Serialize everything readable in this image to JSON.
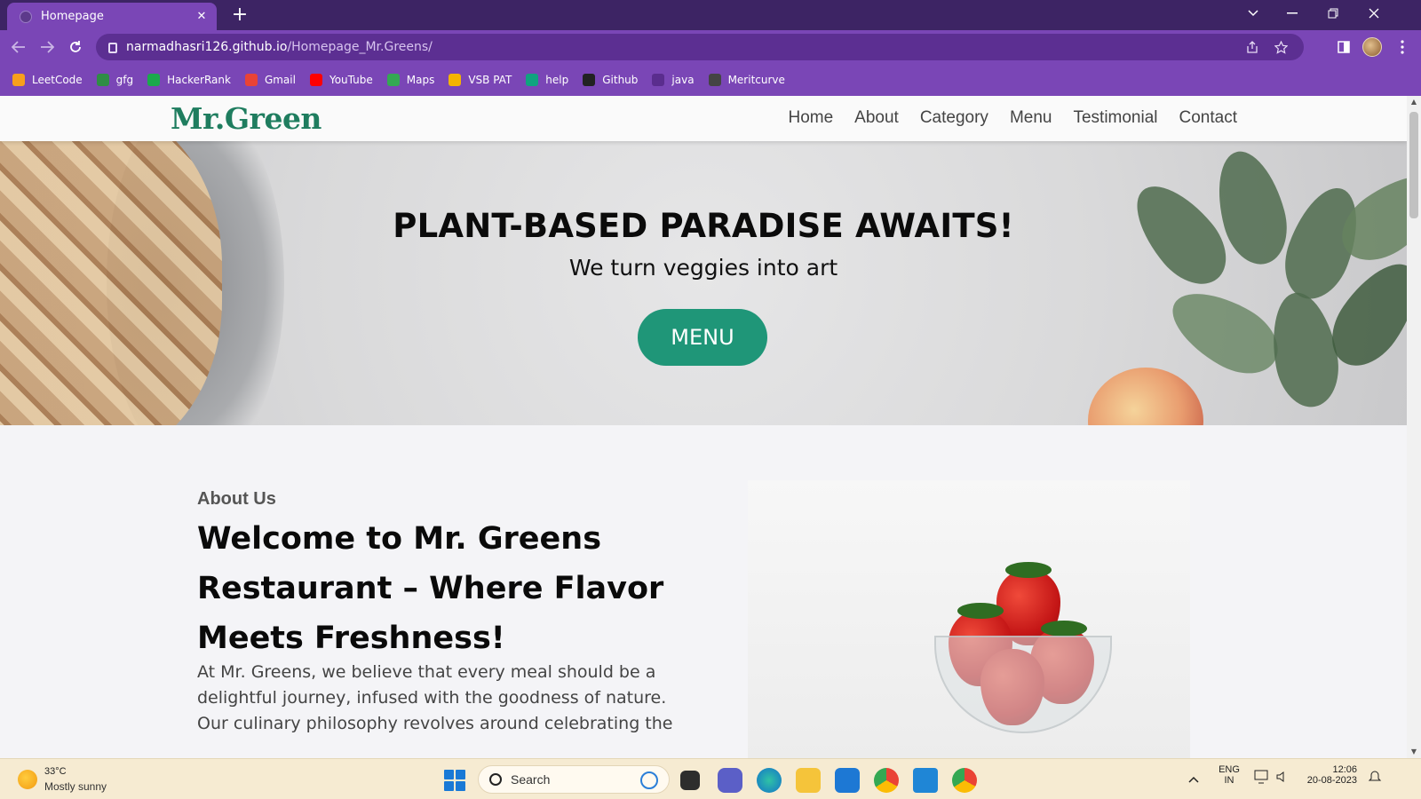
{
  "browser": {
    "tab_title": "Homepage",
    "url_host": "narmadhasri126.github.io",
    "url_path": "/Homepage_Mr.Greens/",
    "new_tab_symbol": "+",
    "close_symbol": "✕",
    "colors": {
      "frame": "#3d2464",
      "toolbar": "#7a46b6",
      "omnibox": "#5c2f92"
    },
    "bookmarks": [
      {
        "label": "LeetCode",
        "icon": "leetcode-icon",
        "color": "#f89f1b"
      },
      {
        "label": "gfg",
        "icon": "gfg-icon",
        "color": "#2f8d46"
      },
      {
        "label": "HackerRank",
        "icon": "hackerrank-icon",
        "color": "#1ba94c"
      },
      {
        "label": "Gmail",
        "icon": "gmail-icon",
        "color": "#ea4335"
      },
      {
        "label": "YouTube",
        "icon": "youtube-icon",
        "color": "#ff0000"
      },
      {
        "label": "Maps",
        "icon": "maps-icon",
        "color": "#34a853"
      },
      {
        "label": "VSB PAT",
        "icon": "vsb-icon",
        "color": "#f4b400"
      },
      {
        "label": "help",
        "icon": "chatgpt-icon",
        "color": "#10a37f"
      },
      {
        "label": "Github",
        "icon": "github-icon",
        "color": "#222222"
      },
      {
        "label": "java",
        "icon": "java-icon",
        "color": "#5a2d8e"
      },
      {
        "label": "Meritcurve",
        "icon": "globe-icon",
        "color": "#444444"
      }
    ]
  },
  "site": {
    "logo": "Mr.Green",
    "logo_color": "#1f7d5f",
    "nav": [
      "Home",
      "About",
      "Category",
      "Menu",
      "Testimonial",
      "Contact"
    ],
    "hero": {
      "title": "PLANT-BASED PARADISE AWAITS!",
      "subtitle": "We turn veggies into art",
      "button": "MENU",
      "button_color": "#1f9678"
    },
    "about": {
      "kicker": "About Us",
      "heading": "Welcome to Mr. Greens Restaurant – Where Flavor Meets Freshness!",
      "body": "At Mr. Greens, we believe that every meal should be a delightful journey, infused with the goodness of nature. Our culinary philosophy revolves around celebrating the"
    }
  },
  "taskbar": {
    "weather_temp": "33°C",
    "weather_desc": "Mostly sunny",
    "search_placeholder": "Search",
    "lang_top": "ENG",
    "lang_bottom": "IN",
    "time": "12:06",
    "date": "20-08-2023"
  }
}
